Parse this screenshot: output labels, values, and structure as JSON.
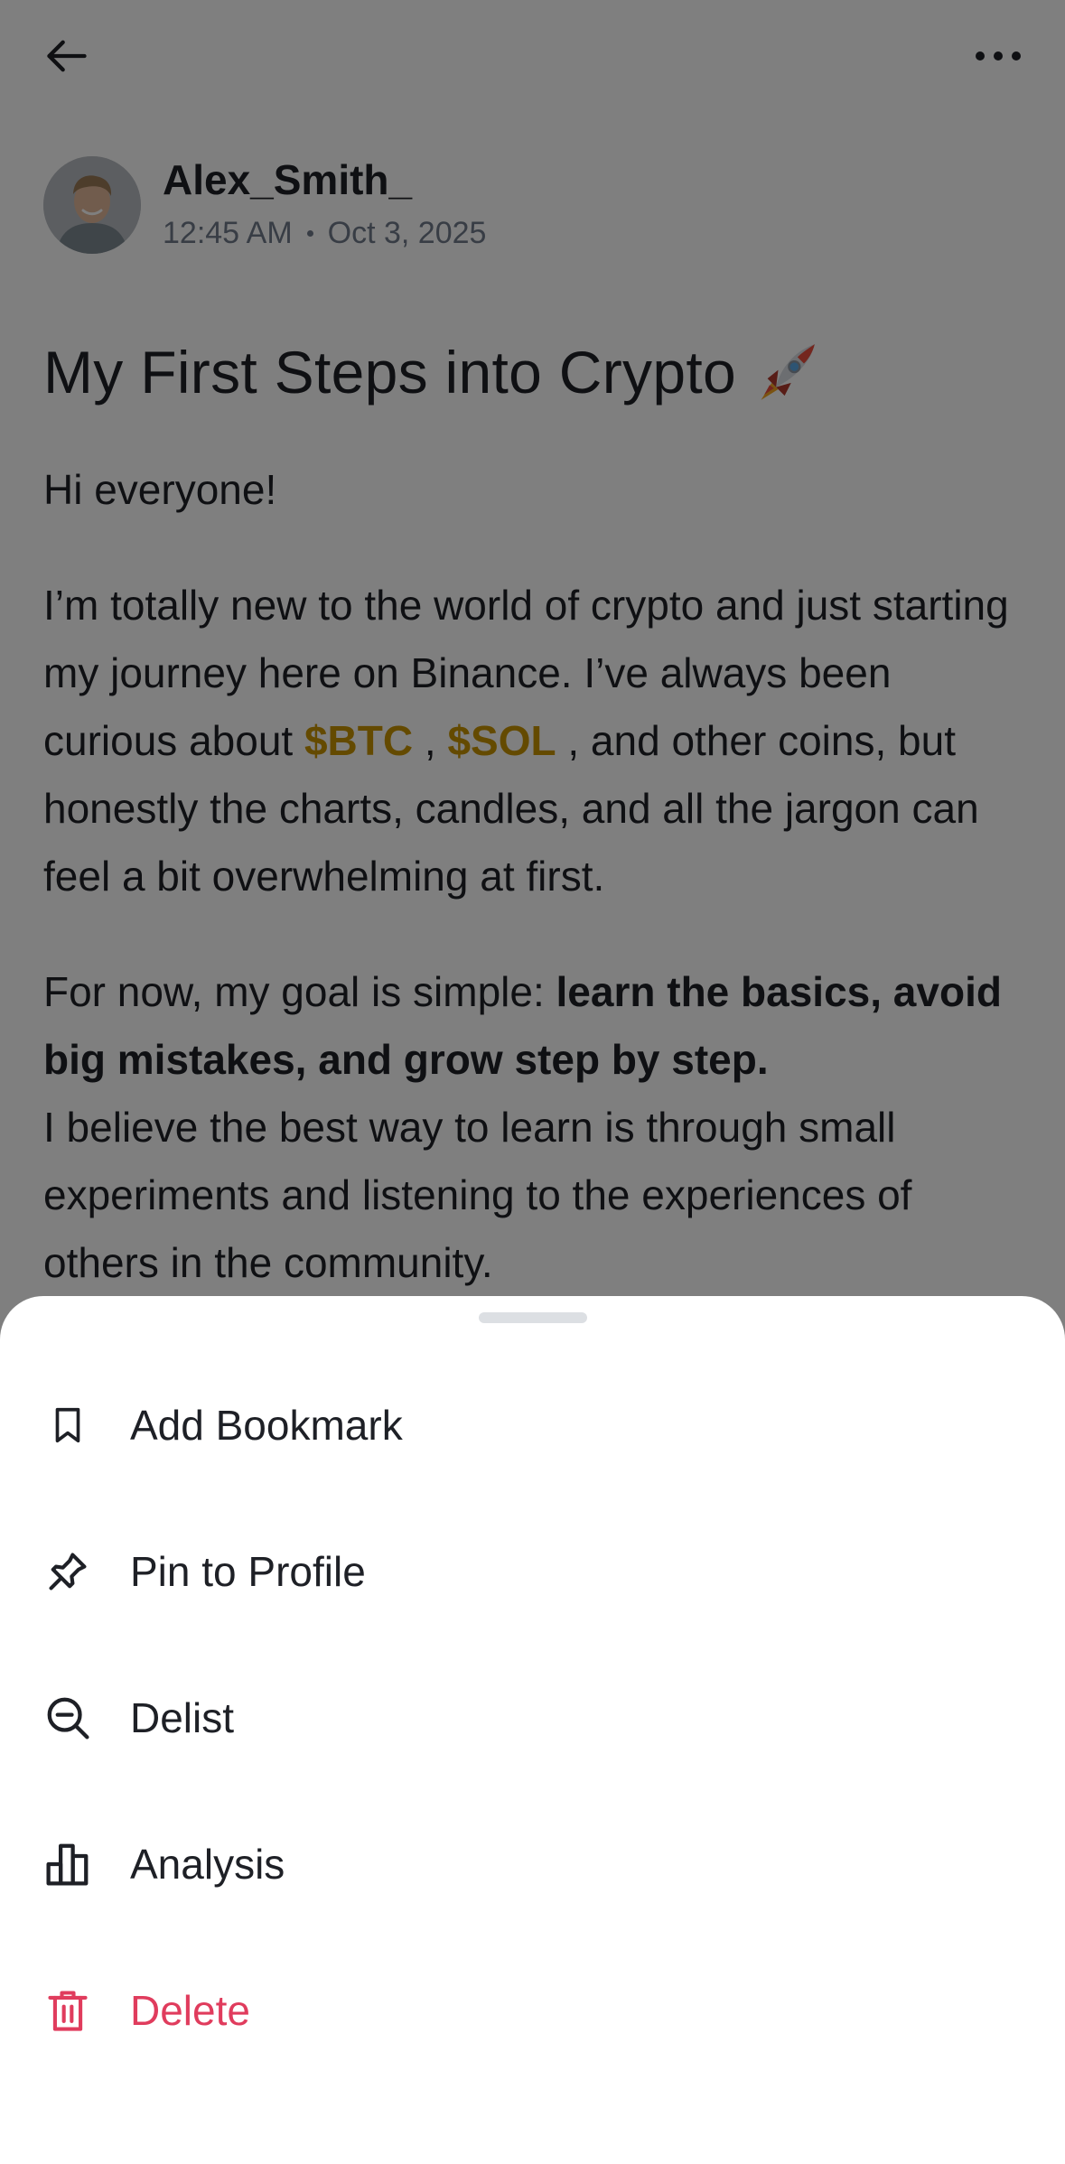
{
  "header": {
    "back_icon": "arrow-left-icon",
    "more_icon": "more-horizontal-icon"
  },
  "author": {
    "name": "Alex_Smith_",
    "time": "12:45 AM",
    "date": "Oct 3, 2025"
  },
  "post": {
    "title": "My First Steps into Crypto",
    "title_emoji": "rocket-icon",
    "greeting": "Hi everyone!",
    "p2_before": "I’m totally new to the world of crypto and just starting my journey here on Binance. I’ve always been curious about ",
    "ticker_1": "$BTC",
    "sep": " , ",
    "ticker_2": "$SOL",
    "p2_after": " , and other coins, but honestly the charts, candles, and all the jargon can feel a bit overwhelming at first.",
    "p3_before": "For now, my goal is simple: ",
    "p3_bold": "learn the basics, avoid big mistakes, and grow step by step.",
    "p4": "I believe the best way to learn is through small experiments and listening to the experiences of others in the community."
  },
  "sheet": {
    "items": [
      {
        "label": "Add Bookmark",
        "icon": "bookmark-icon"
      },
      {
        "label": "Pin to Profile",
        "icon": "pin-icon"
      },
      {
        "label": "Delist",
        "icon": "zoom-out-icon"
      },
      {
        "label": "Analysis",
        "icon": "bar-chart-icon"
      },
      {
        "label": "Delete",
        "icon": "trash-icon"
      }
    ]
  },
  "colors": {
    "ticker": "#c99400",
    "danger": "#e03c5d",
    "text": "#1e2026",
    "muted": "#707a8a"
  }
}
